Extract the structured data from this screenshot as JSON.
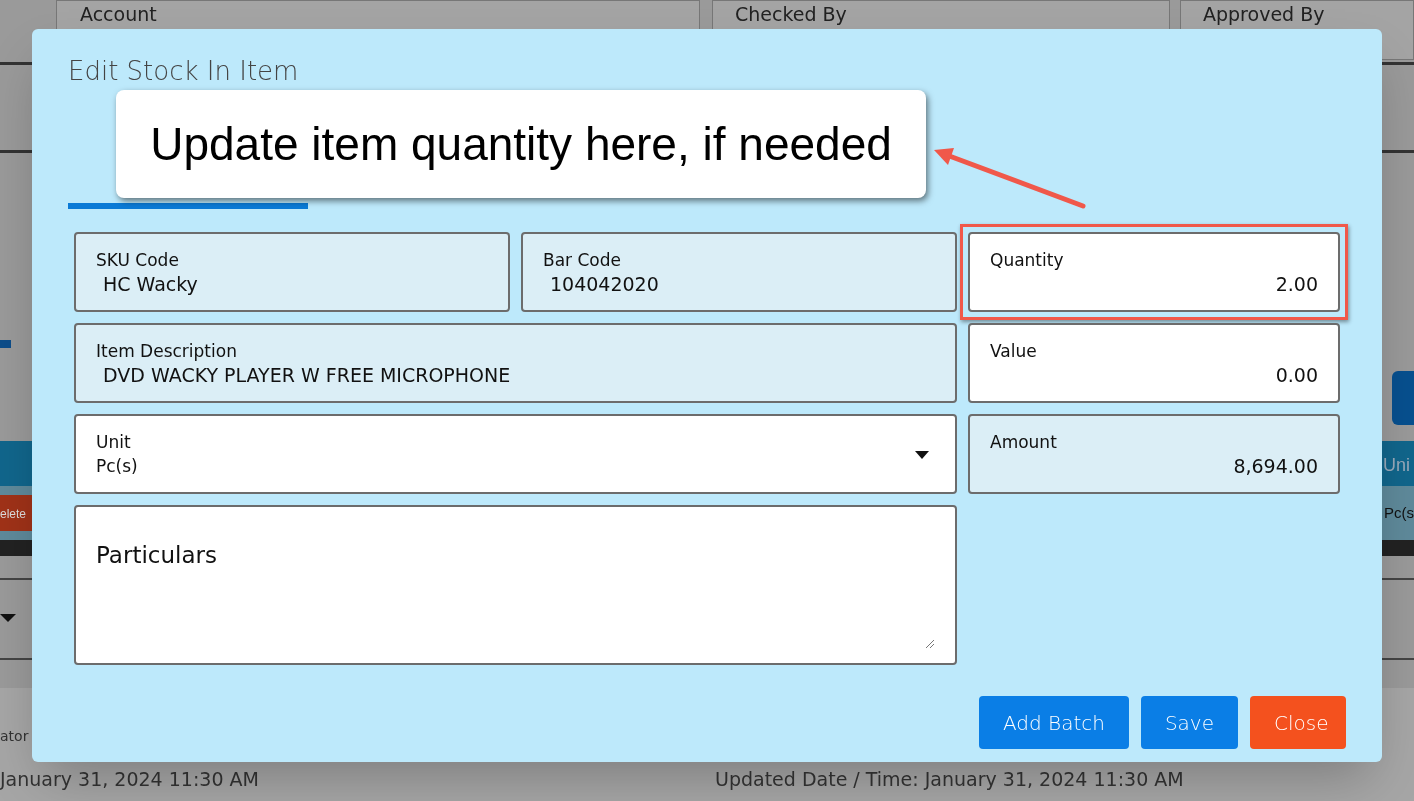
{
  "background": {
    "headers": [
      "Account",
      "Checked By",
      "Approved By"
    ],
    "delete_button": "elete",
    "unit_header": "Uni",
    "unit_cell": "Pc(s",
    "footer_left_label": "ator",
    "footer_left_date": "January 31, 2024 11:30 AM",
    "footer_right": "Updated Date / Time: January 31, 2024 11:30 AM"
  },
  "dialog": {
    "title": "Edit Stock In Item",
    "fields": [
      {
        "kind": "readonly",
        "label": "SKU Code",
        "value": "HC Wacky",
        "highlighted": false
      },
      {
        "kind": "readonly",
        "label": "Bar Code",
        "value": "104042020",
        "highlighted": false
      },
      {
        "kind": "input",
        "label": "Quantity",
        "value": "2.00",
        "highlighted": true
      },
      {
        "kind": "readonly",
        "label": "Item Description",
        "value": "DVD WACKY PLAYER W FREE MICROPHONE",
        "highlighted": false
      },
      {
        "kind": "input",
        "label": "Value",
        "value": "0.00",
        "highlighted": false
      },
      {
        "kind": "select",
        "label": "Unit",
        "value": "Pc(s)",
        "highlighted": false
      },
      {
        "kind": "readonly",
        "label": "Amount",
        "value": "8,694.00",
        "highlighted": false
      },
      {
        "kind": "textarea",
        "placeholder": "Particulars",
        "highlighted": false
      }
    ],
    "buttons": [
      {
        "label": "Add Batch",
        "kind": "primary"
      },
      {
        "label": "Save",
        "kind": "primary"
      },
      {
        "label": "Close",
        "kind": "danger"
      }
    ]
  },
  "callout": {
    "text": "Update item quantity here, if needed"
  }
}
